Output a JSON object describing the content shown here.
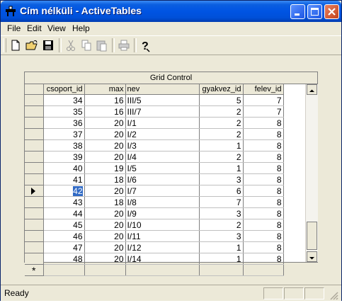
{
  "window": {
    "title": "Cím nélküli - ActiveTables"
  },
  "menu": {
    "file": "File",
    "edit": "Edit",
    "view": "View",
    "help": "Help"
  },
  "toolbar": {
    "icons": [
      "new-file-icon",
      "open-folder-icon",
      "save-icon",
      "cut-icon",
      "copy-icon",
      "paste-icon",
      "print-icon",
      "help-icon"
    ]
  },
  "grid": {
    "caption": "Grid Control",
    "columns": [
      "csoport_id",
      "max",
      "nev",
      "gyakvez_id",
      "felev_id"
    ],
    "rows": [
      {
        "csoport_id": "34",
        "max": "16",
        "nev": "III/5",
        "gyakvez_id": "5",
        "felev_id": "7"
      },
      {
        "csoport_id": "35",
        "max": "16",
        "nev": "III/7",
        "gyakvez_id": "2",
        "felev_id": "7"
      },
      {
        "csoport_id": "36",
        "max": "20",
        "nev": "I/1",
        "gyakvez_id": "2",
        "felev_id": "8"
      },
      {
        "csoport_id": "37",
        "max": "20",
        "nev": "I/2",
        "gyakvez_id": "2",
        "felev_id": "8"
      },
      {
        "csoport_id": "38",
        "max": "20",
        "nev": "I/3",
        "gyakvez_id": "1",
        "felev_id": "8"
      },
      {
        "csoport_id": "39",
        "max": "20",
        "nev": "I/4",
        "gyakvez_id": "2",
        "felev_id": "8"
      },
      {
        "csoport_id": "40",
        "max": "19",
        "nev": "I/5",
        "gyakvez_id": "1",
        "felev_id": "8"
      },
      {
        "csoport_id": "41",
        "max": "18",
        "nev": "I/6",
        "gyakvez_id": "3",
        "felev_id": "8"
      },
      {
        "csoport_id": "42",
        "max": "20",
        "nev": "I/7",
        "gyakvez_id": "6",
        "felev_id": "8"
      },
      {
        "csoport_id": "43",
        "max": "18",
        "nev": "I/8",
        "gyakvez_id": "7",
        "felev_id": "8"
      },
      {
        "csoport_id": "44",
        "max": "20",
        "nev": "I/9",
        "gyakvez_id": "3",
        "felev_id": "8"
      },
      {
        "csoport_id": "45",
        "max": "20",
        "nev": "I/10",
        "gyakvez_id": "2",
        "felev_id": "8"
      },
      {
        "csoport_id": "46",
        "max": "20",
        "nev": "I/11",
        "gyakvez_id": "3",
        "felev_id": "8"
      },
      {
        "csoport_id": "47",
        "max": "20",
        "nev": "I/12",
        "gyakvez_id": "1",
        "felev_id": "8"
      },
      {
        "csoport_id": "48",
        "max": "20",
        "nev": "I/14",
        "gyakvez_id": "1",
        "felev_id": "8"
      }
    ],
    "new_row_marker": "*"
  },
  "status": {
    "text": "Ready"
  }
}
